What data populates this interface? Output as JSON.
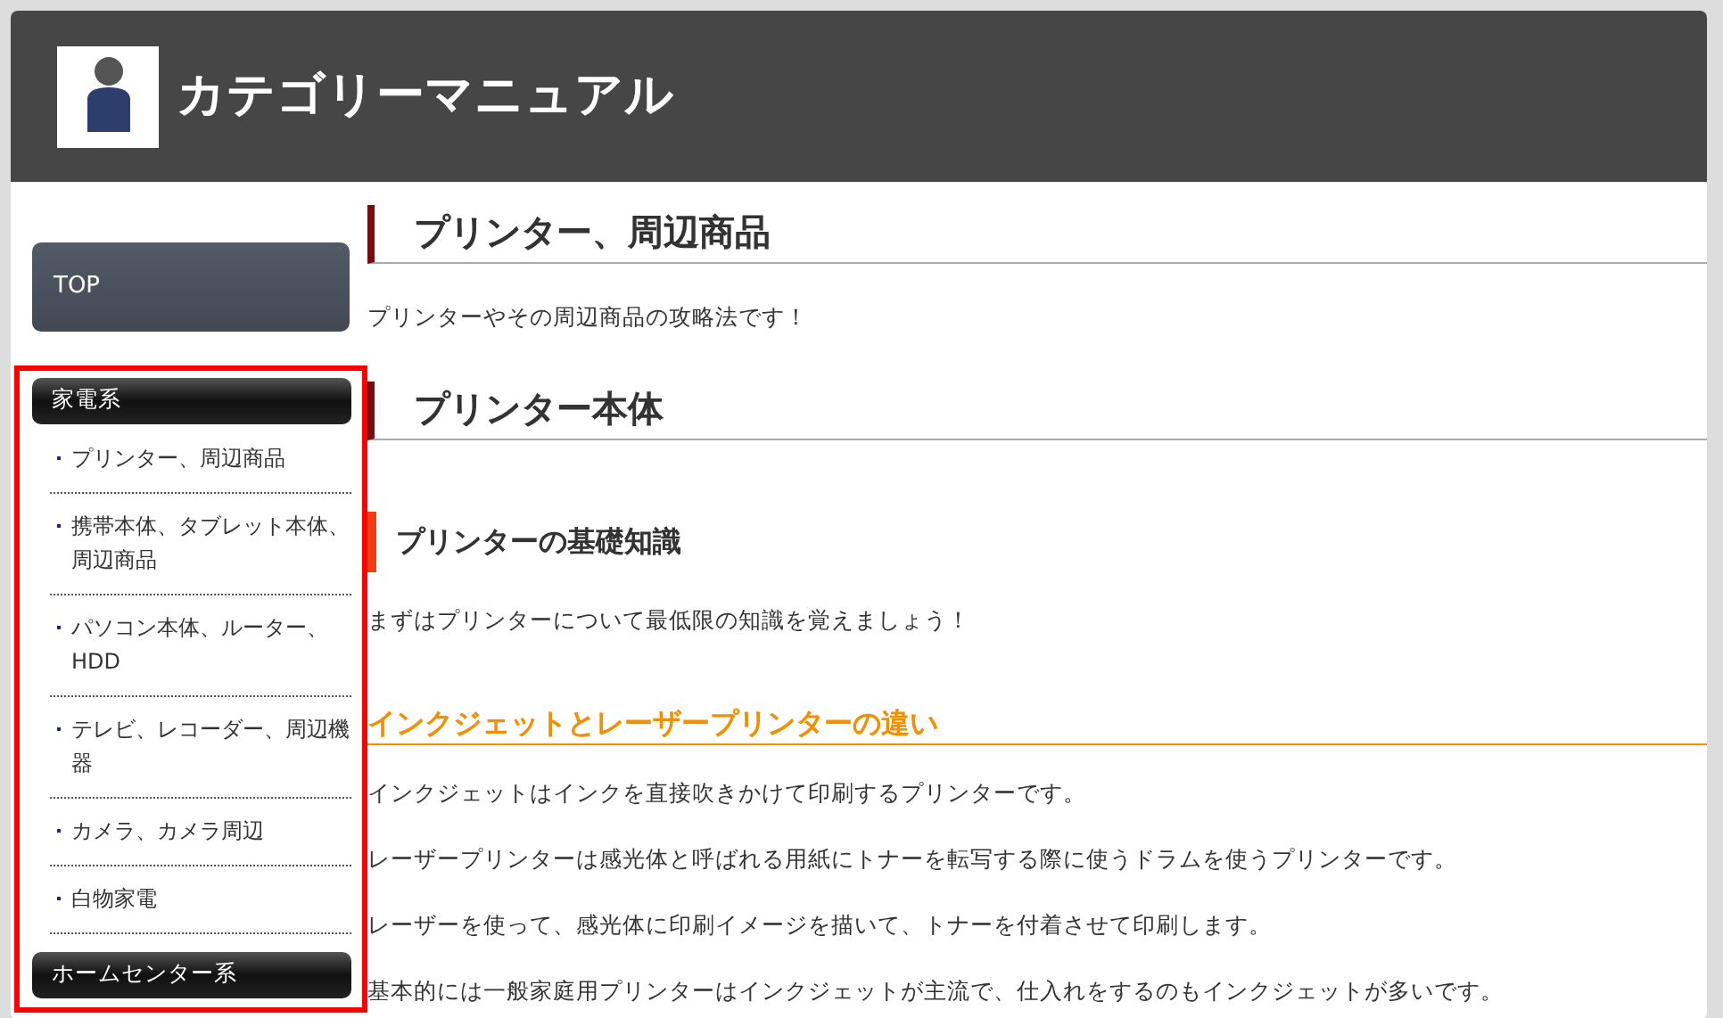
{
  "header": {
    "title": "カテゴリーマニュアル"
  },
  "sidebar": {
    "top_link": "TOP",
    "groups": [
      {
        "title": "家電系",
        "items": [
          "プリンター、周辺商品",
          "携帯本体、タブレット本体、周辺商品",
          "パソコン本体、ルーター、HDD",
          "テレビ、レコーダー、周辺機器",
          "カメラ、カメラ周辺",
          "白物家電"
        ]
      },
      {
        "title": "ホームセンター系"
      }
    ]
  },
  "main": {
    "blocks": [
      {
        "kind": "h2",
        "text": "プリンター、周辺商品"
      },
      {
        "kind": "p",
        "text": "プリンターやその周辺商品の攻略法です！"
      },
      {
        "kind": "h2",
        "text": "プリンター本体"
      },
      {
        "kind": "h3",
        "text": "プリンターの基礎知識"
      },
      {
        "kind": "p",
        "text": "まずはプリンターについて最低限の知識を覚えましょう！"
      },
      {
        "kind": "h4",
        "text": "インクジェットとレーザープリンターの違い"
      },
      {
        "kind": "p",
        "text": "インクジェットはインクを直接吹きかけて印刷するプリンターです。"
      },
      {
        "kind": "p",
        "text": "レーザープリンターは感光体と呼ばれる用紙にトナーを転写する際に使うドラムを使うプリンターです。"
      },
      {
        "kind": "p",
        "text": "レーザーを使って、感光体に印刷イメージを描いて、トナーを付着させて印刷します。"
      },
      {
        "kind": "p",
        "text": "基本的には一般家庭用プリンターはインクジェットが主流で、仕入れをするのもインクジェットが多いです。"
      }
    ]
  }
}
